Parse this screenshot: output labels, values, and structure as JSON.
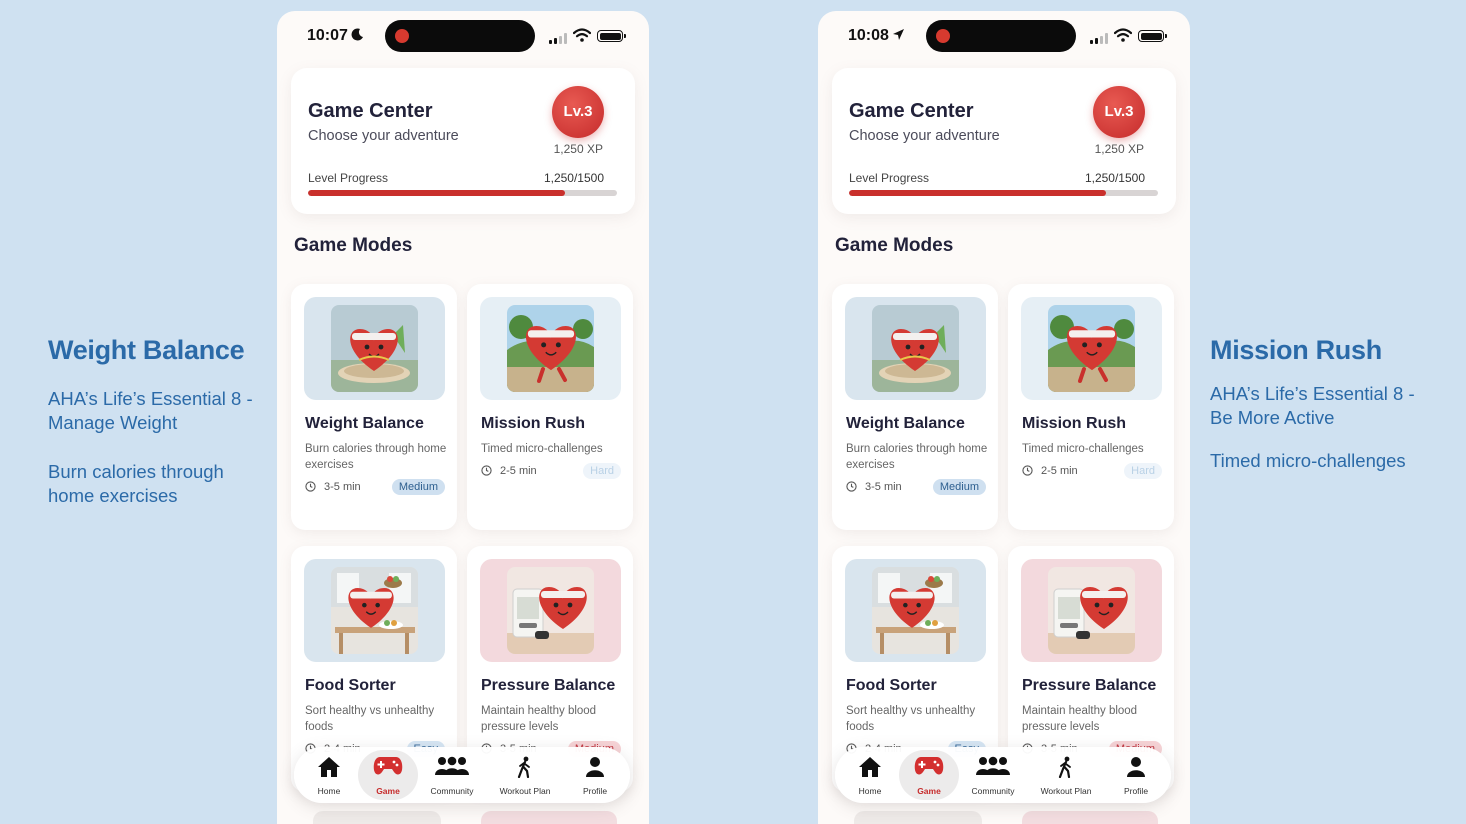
{
  "left_caption": {
    "title": "Weight Balance",
    "line1": "AHA’s Life’s Essential 8 -",
    "line2": "Manage Weight",
    "line3": "Burn calories through",
    "line4": "home exercises"
  },
  "right_caption": {
    "title": "Mission Rush",
    "line1": "AHA’s Life’s Essential 8 -",
    "line2": "Be More Active",
    "line3": "Timed micro-challenges"
  },
  "phone_left": {
    "time": "10:07",
    "time_icon": "moon-icon"
  },
  "phone_right": {
    "time": "10:08",
    "time_icon": "location-arrow-icon"
  },
  "game_center": {
    "title": "Game Center",
    "subtitle": "Choose your adventure",
    "level_badge": "Lv.3",
    "xp": "1,250 XP",
    "progress_label": "Level Progress",
    "progress_value": "1,250/1500",
    "progress_fraction": 0.8333
  },
  "game_modes_title": "Game Modes",
  "modes": [
    {
      "name": "Weight Balance",
      "desc": "Burn calories through home exercises",
      "duration": "3-5 min",
      "difficulty": "Medium",
      "image_icon": "heart-mascot-meditating-icon"
    },
    {
      "name": "Mission Rush",
      "desc": "Timed micro-challenges",
      "duration": "2-5 min",
      "difficulty": "Hard",
      "image_icon": "heart-mascot-running-icon"
    },
    {
      "name": "Food Sorter",
      "desc": "Sort healthy vs unhealthy foods",
      "duration": "2-4 min",
      "difficulty": "Easy",
      "image_icon": "heart-mascot-food-icon"
    },
    {
      "name": "Pressure Balance",
      "desc": "Maintain healthy blood pressure levels",
      "duration": "3-5 min",
      "difficulty": "Medium",
      "image_icon": "heart-mascot-blood-pressure-icon"
    }
  ],
  "nav": {
    "home": "Home",
    "game": "Game",
    "community": "Community",
    "workout": "Workout Plan",
    "profile": "Profile"
  },
  "colors": {
    "background": "#cfe1f1",
    "accent_red": "#c9302c",
    "caption_blue": "#2b6aa8",
    "title_dark": "#22223a"
  }
}
